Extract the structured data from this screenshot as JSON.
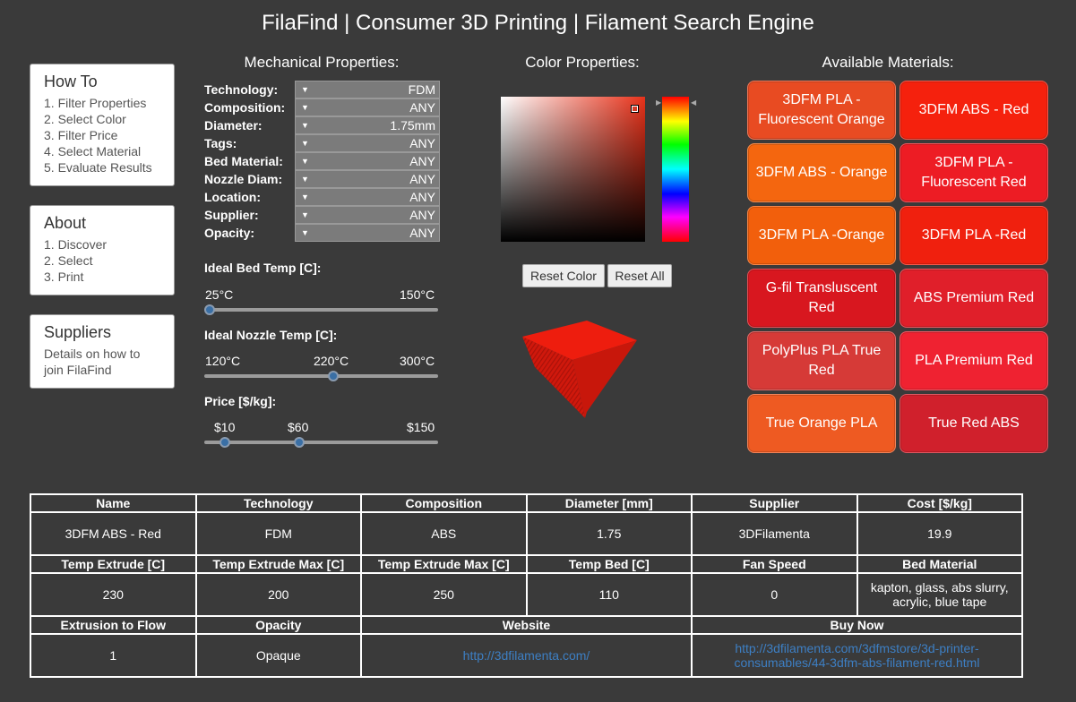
{
  "app_title": "FilaFind | Consumer 3D Printing | Filament Search Engine",
  "sidebar": {
    "howto": {
      "title": "How To",
      "items": [
        "1. Filter Properties",
        "2. Select Color",
        "3. Filter Price",
        "4. Select Material",
        "5. Evaluate Results"
      ]
    },
    "about": {
      "title": "About",
      "items": [
        "1. Discover",
        "2. Select",
        "3. Print"
      ]
    },
    "suppliers": {
      "title": "Suppliers",
      "items": [
        "Details on how to",
        "join FilaFind"
      ]
    }
  },
  "mechanical": {
    "title": "Mechanical Properties:",
    "fields": [
      {
        "label": "Technology:",
        "value": "FDM"
      },
      {
        "label": "Composition:",
        "value": "ANY"
      },
      {
        "label": "Diameter:",
        "value": "1.75mm"
      },
      {
        "label": "Tags:",
        "value": "ANY"
      },
      {
        "label": "Bed Material:",
        "value": "ANY"
      },
      {
        "label": "Nozzle Diam:",
        "value": "ANY"
      },
      {
        "label": "Location:",
        "value": "ANY"
      },
      {
        "label": "Supplier:",
        "value": "ANY"
      },
      {
        "label": "Opacity:",
        "value": "ANY"
      }
    ],
    "bed_temp": {
      "label": "Ideal Bed Temp [C]:",
      "min": "25°C",
      "max": "150°C",
      "value": 25,
      "range": [
        25,
        150
      ]
    },
    "nozzle_temp": {
      "label": "Ideal Nozzle Temp [C]:",
      "min": "120°C",
      "current": "220°C",
      "max": "300°C",
      "value": 220,
      "range": [
        120,
        300
      ]
    },
    "price": {
      "label": "Price [$/kg]:",
      "low_label": "$10",
      "high_label": "$60",
      "max": "$150",
      "low": 10,
      "high": 60,
      "range": [
        0,
        150
      ]
    }
  },
  "color": {
    "title": "Color Properties:",
    "hue_color": "#e8321a",
    "reset_color": "Reset Color",
    "reset_all": "Reset All"
  },
  "materials": {
    "title": "Available Materials:",
    "items": [
      {
        "name": "3DFM PLA - Fluorescent Orange",
        "color": "#e84b22"
      },
      {
        "name": "3DFM ABS - Red",
        "color": "#f5210d"
      },
      {
        "name": "3DFM ABS - Orange",
        "color": "#f4660f"
      },
      {
        "name": "3DFM PLA - Fluorescent Red",
        "color": "#ed1c24"
      },
      {
        "name": "3DFM PLA -Orange",
        "color": "#f25f0c"
      },
      {
        "name": "3DFM PLA -Red",
        "color": "#f0200e"
      },
      {
        "name": "G-fil Transluscent Red",
        "color": "#d8171f"
      },
      {
        "name": "ABS Premium Red",
        "color": "#e01f2a"
      },
      {
        "name": "PolyPlus PLA True Red",
        "color": "#d63a37"
      },
      {
        "name": "PLA Premium Red",
        "color": "#ef2231"
      },
      {
        "name": "True Orange PLA",
        "color": "#ee5a22"
      },
      {
        "name": "True Red ABS",
        "color": "#d0202c"
      }
    ]
  },
  "details": {
    "h1": [
      "Name",
      "Technology",
      "Composition",
      "Diameter [mm]",
      "Supplier",
      "Cost [$/kg]"
    ],
    "r1": [
      "3DFM ABS - Red",
      "FDM",
      "ABS",
      "1.75",
      "3DFilamenta",
      "19.9"
    ],
    "h2": [
      "Temp Extrude [C]",
      "Temp Extrude Max [C]",
      "Temp Extrude Max [C]",
      "Temp Bed [C]",
      "Fan Speed",
      "Bed Material"
    ],
    "r2": [
      "230",
      "200",
      "250",
      "110",
      "0",
      "kapton, glass, abs slurry, acrylic, blue tape"
    ],
    "h3": [
      "Extrusion to Flow",
      "Opacity",
      "Website",
      "Buy Now"
    ],
    "r3": [
      "1",
      "Opaque",
      "http://3dfilamenta.com/",
      "http://3dfilamenta.com/3dfmstore/3d-printer-consumables/44-3dfm-abs-filament-red.html"
    ]
  }
}
